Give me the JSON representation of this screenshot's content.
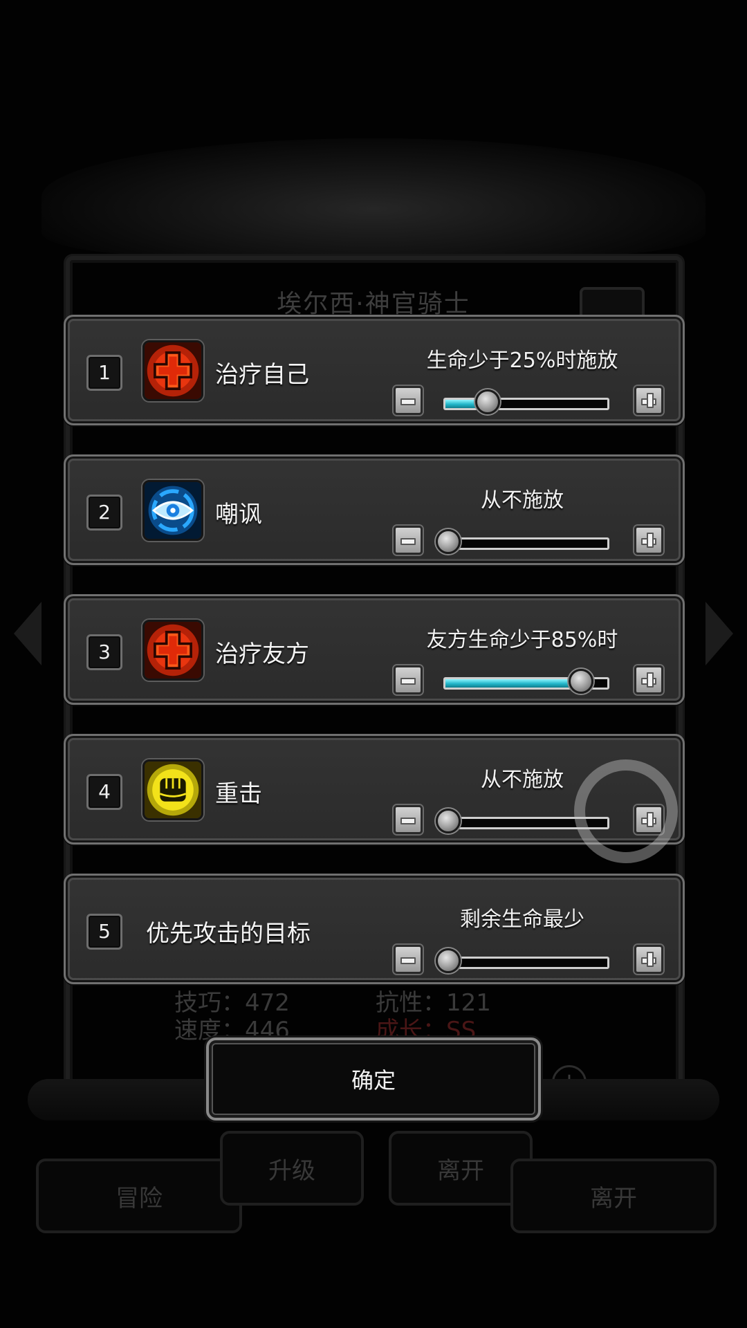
{
  "background": {
    "hero_title": "埃尔西·神官骑士",
    "stats_left": [
      "技巧：472",
      "速度：446"
    ],
    "stats_right": [
      "抗性：121",
      "成长：SS"
    ],
    "buttons": [
      "冒险",
      "升级",
      "离开",
      "离开"
    ]
  },
  "panels": [
    {
      "number": "1",
      "icon": "heal-cross-icon",
      "name": "治疗自己",
      "condition": "生命少于25%时施放",
      "level": 0.25
    },
    {
      "number": "2",
      "icon": "eye-vortex-icon",
      "name": "嘲讽",
      "condition": "从不施放",
      "level": 0
    },
    {
      "number": "3",
      "icon": "heal-cross-icon",
      "name": "治疗友方",
      "condition": "友方生命少于85%时",
      "level": 0.85
    },
    {
      "number": "4",
      "icon": "fist-icon",
      "name": "重击",
      "condition": "从不施放",
      "level": 0
    },
    {
      "number": "5",
      "name": "优先攻击的目标",
      "condition": "剩余生命最少",
      "level": 0
    }
  ],
  "confirm_label": "确定",
  "colors": {
    "slider_fill": "#22b5c9",
    "panel_bg": "#2e2e2e",
    "heal_icon": "#e8350f",
    "eye_icon": "#2aa8ff",
    "fist_icon": "#f2e21a"
  }
}
